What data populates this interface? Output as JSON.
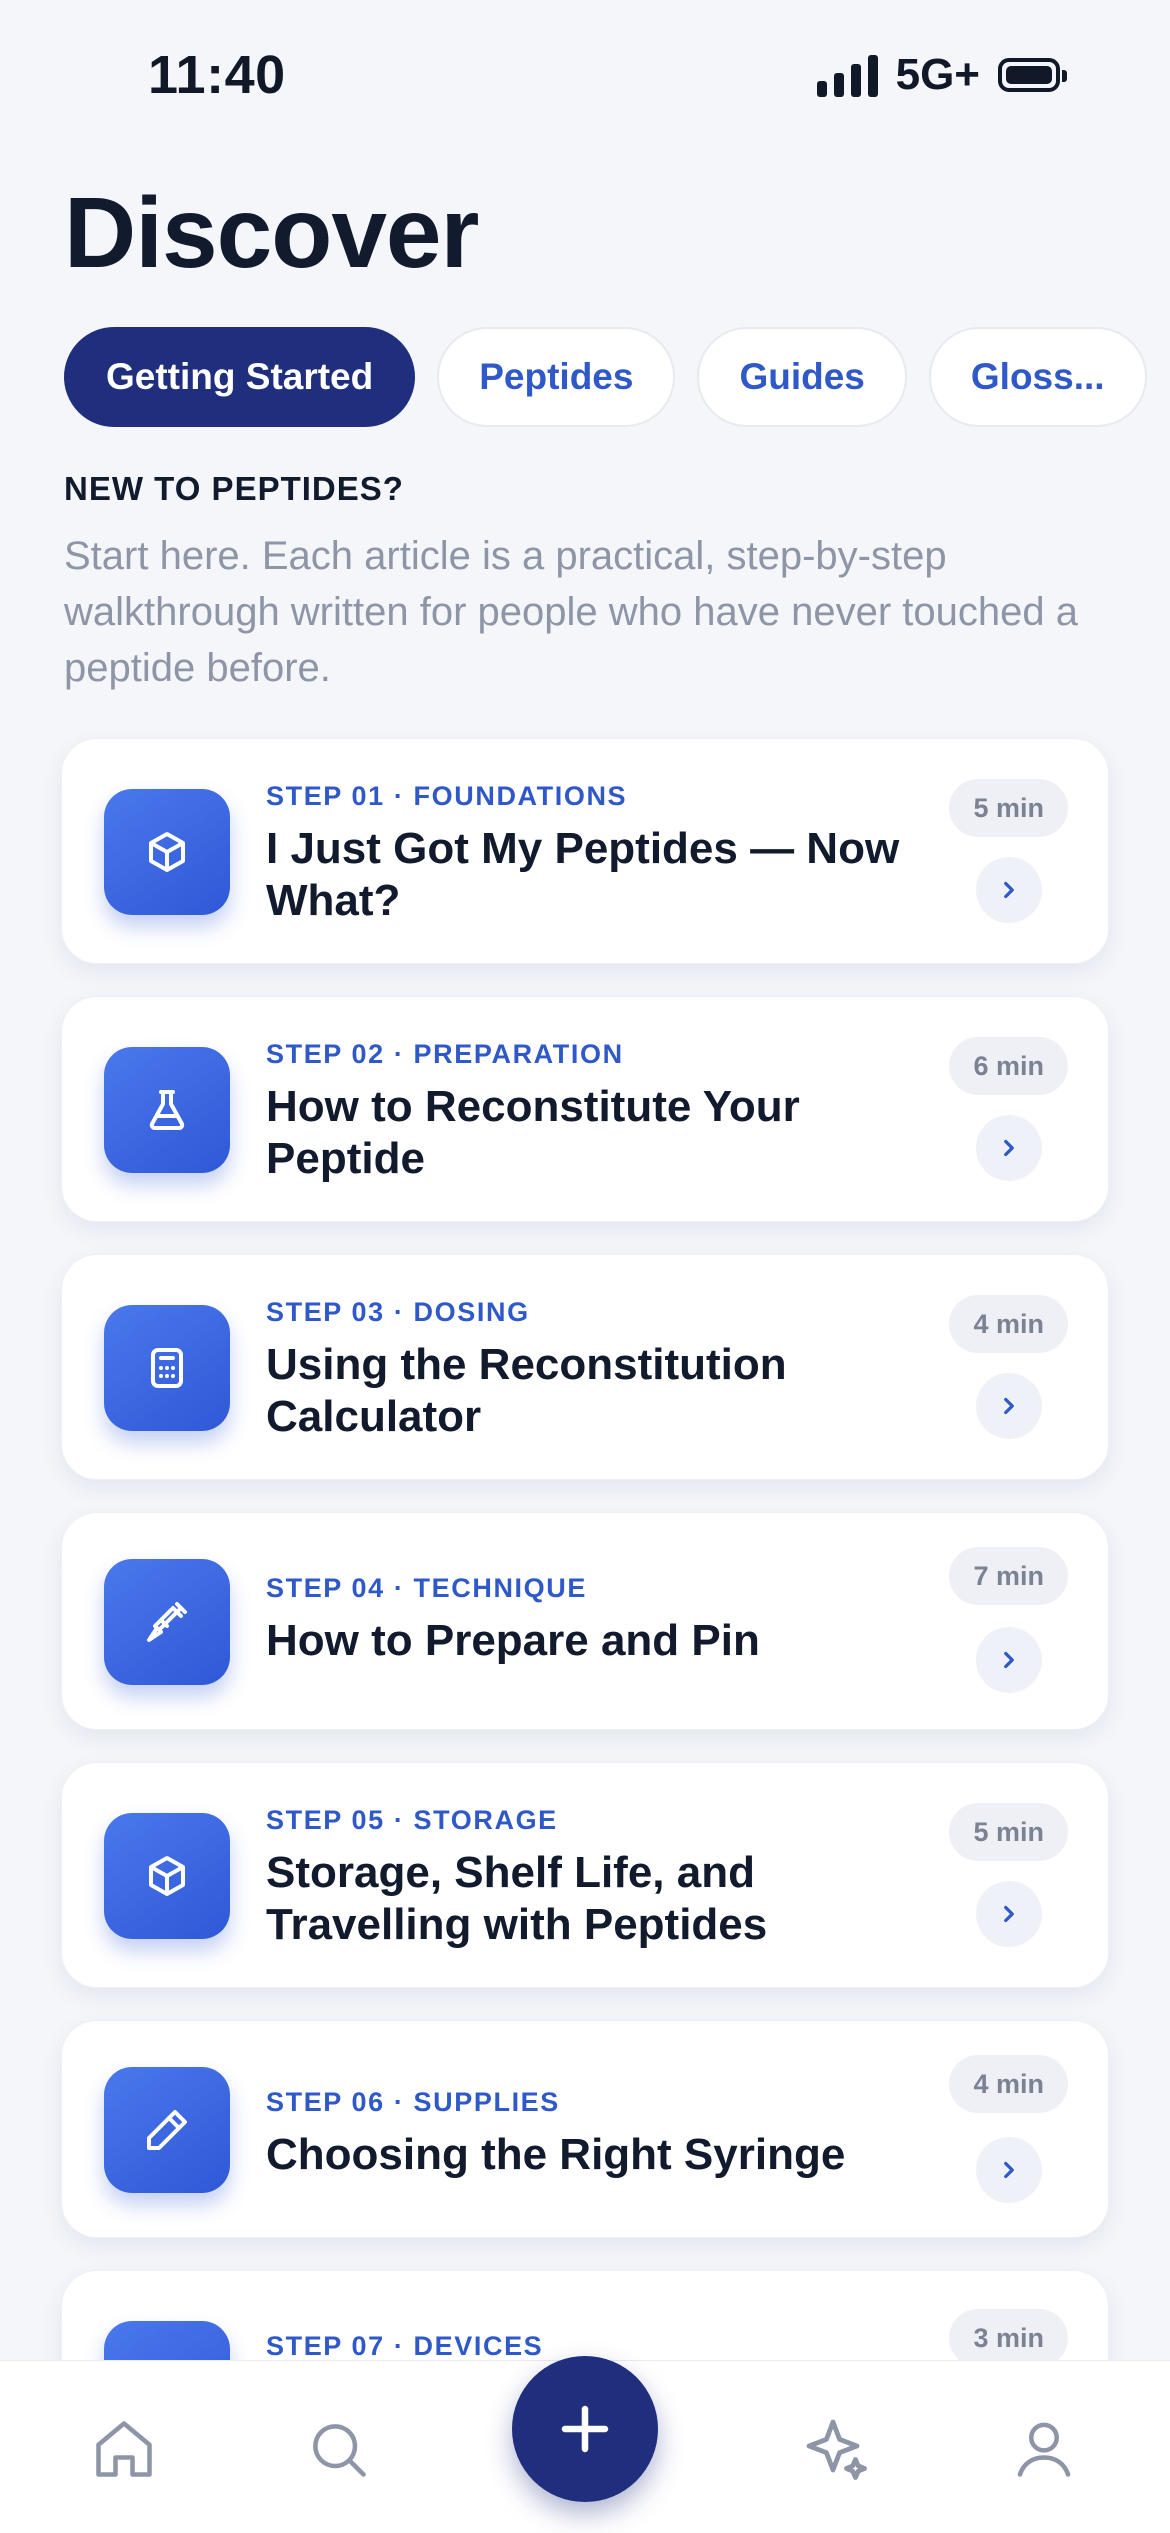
{
  "status_bar": {
    "time": "11:40",
    "network": "5G+"
  },
  "page": {
    "title": "Discover"
  },
  "tabs": [
    {
      "label": "Getting Started",
      "active": true
    },
    {
      "label": "Peptides",
      "active": false
    },
    {
      "label": "Guides",
      "active": false
    },
    {
      "label": "Gloss...",
      "active": false
    }
  ],
  "section": {
    "label": "NEW TO PEPTIDES?",
    "description": "Start here. Each article is a practical, step-by-step walkthrough written for people who have never touched a peptide before."
  },
  "articles": [
    {
      "step": "STEP 01 · FOUNDATIONS",
      "title": "I Just Got My Peptides — Now What?",
      "duration": "5 min",
      "icon": "cube-icon"
    },
    {
      "step": "STEP 02 · PREPARATION",
      "title": "How to Reconstitute Your Peptide",
      "duration": "6 min",
      "icon": "flask-icon"
    },
    {
      "step": "STEP 03 · DOSING",
      "title": "Using the Reconstitution Calculator",
      "duration": "4 min",
      "icon": "calculator-icon"
    },
    {
      "step": "STEP 04 · TECHNIQUE",
      "title": "How to Prepare and Pin",
      "duration": "7 min",
      "icon": "syringe-icon"
    },
    {
      "step": "STEP 05 · STORAGE",
      "title": "Storage, Shelf Life, and Travelling with Peptides",
      "duration": "5 min",
      "icon": "cube-icon"
    },
    {
      "step": "STEP 06 · SUPPLIES",
      "title": "Choosing the Right Syringe",
      "duration": "4 min",
      "icon": "pen-icon"
    },
    {
      "step": "STEP 07 · DEVICES",
      "title": "",
      "duration": "3 min",
      "icon": "device-icon"
    }
  ],
  "bottom_nav": [
    {
      "icon": "home-icon"
    },
    {
      "icon": "search-icon"
    },
    {
      "icon": "plus-icon"
    },
    {
      "icon": "sparkle-icon"
    },
    {
      "icon": "profile-icon"
    }
  ],
  "colors": {
    "accent": "#2f58c9",
    "primary_dark": "#1f2f7d",
    "background": "#f4f6fa"
  },
  "signal_bars_filled": 4,
  "battery_level": 1.0
}
